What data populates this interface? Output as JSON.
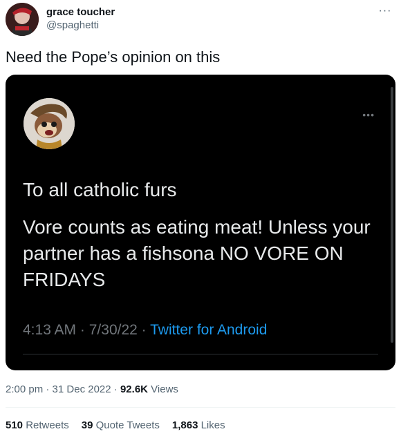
{
  "author": {
    "display_name": "grace toucher",
    "handle": "@spaghetti"
  },
  "tweet": {
    "text": "Need the Pope’s opinion on this"
  },
  "embedded_tweet": {
    "line1": "To all catholic furs",
    "line2": "Vore counts as eating meat! Unless your partner has a fishsona NO VORE ON FRIDAYS",
    "time": "4:13 AM",
    "date": "7/30/22",
    "separator": "·",
    "source": "Twitter for Android"
  },
  "meta": {
    "time": "2:00 pm",
    "date": "31 Dec 2022",
    "separator": "·",
    "views_count": "92.6K",
    "views_label": "Views"
  },
  "stats": {
    "retweets_count": "510",
    "retweets_label": "Retweets",
    "quotes_count": "39",
    "quotes_label": "Quote Tweets",
    "likes_count": "1,863",
    "likes_label": "Likes"
  },
  "icons": {
    "more": "more-dots-icon"
  },
  "colors": {
    "link": "#1d9bf0",
    "secondary_text": "#536471",
    "embed_background": "#000000"
  }
}
